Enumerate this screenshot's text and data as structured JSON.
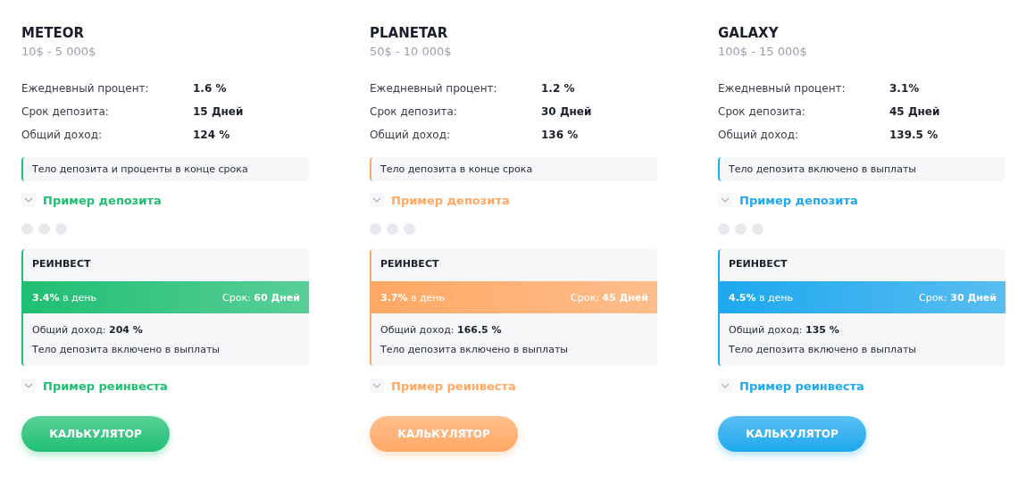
{
  "plans": [
    {
      "name": "METEOR",
      "range": "10$ - 5 000$",
      "color": "#1fbf73",
      "stats": [
        {
          "label": "Ежедневный процент:",
          "value": "1.6 %"
        },
        {
          "label": "Срок депозита:",
          "value": "15 Дней"
        },
        {
          "label": "Общий доход:",
          "value": "124 %"
        }
      ],
      "note": "Тело депозита и проценты в конце срока",
      "deposit_example": "Пример депозита",
      "reinvest": {
        "title": "РЕИНВЕСТ",
        "rate": "3.4%",
        "rate_suffix": "в день",
        "term_label": "Срок:",
        "term": "60 Дней",
        "income_label": "Общий доход:",
        "income": "204 %",
        "note": "Тело депозита включено в выплаты"
      },
      "reinvest_example": "Пример реинвеста",
      "button": "КАЛЬКУЛЯТОР"
    },
    {
      "name": "PLANETAR",
      "range": "50$ - 10 000$",
      "color": "#ffa864",
      "stats": [
        {
          "label": "Ежедневный процент:",
          "value": "1.2 %"
        },
        {
          "label": "Срок депозита:",
          "value": "30 Дней"
        },
        {
          "label": "Общий доход:",
          "value": "136 %"
        }
      ],
      "note": "Тело депозита в конце срока",
      "deposit_example": "Пример депозита",
      "reinvest": {
        "title": "РЕИНВЕСТ",
        "rate": "3.7%",
        "rate_suffix": "в день",
        "term_label": "Срок:",
        "term": "45 Дней",
        "income_label": "Общий доход:",
        "income": "166.5 %",
        "note": "Тело депозита включено в выплаты"
      },
      "reinvest_example": "Пример реинвеста",
      "button": "КАЛЬКУЛЯТОР"
    },
    {
      "name": "GALAXY",
      "range": "100$ - 15 000$",
      "color": "#1ea8ee",
      "stats": [
        {
          "label": "Ежедневный процент:",
          "value": "3.1%"
        },
        {
          "label": "Срок депозита:",
          "value": "45 Дней"
        },
        {
          "label": "Общий доход:",
          "value": "139.5 %"
        }
      ],
      "note": "Тело депозита включено в выплаты",
      "deposit_example": "Пример депозита",
      "reinvest": {
        "title": "РЕИНВЕСТ",
        "rate": "4.5%",
        "rate_suffix": "в день",
        "term_label": "Срок:",
        "term": "30 Дней",
        "income_label": "Общий доход:",
        "income": "135 %",
        "note": "Тело депозита включено в выплаты"
      },
      "reinvest_example": "Пример реинвеста",
      "button": "КАЛЬКУЛЯТОР"
    }
  ]
}
